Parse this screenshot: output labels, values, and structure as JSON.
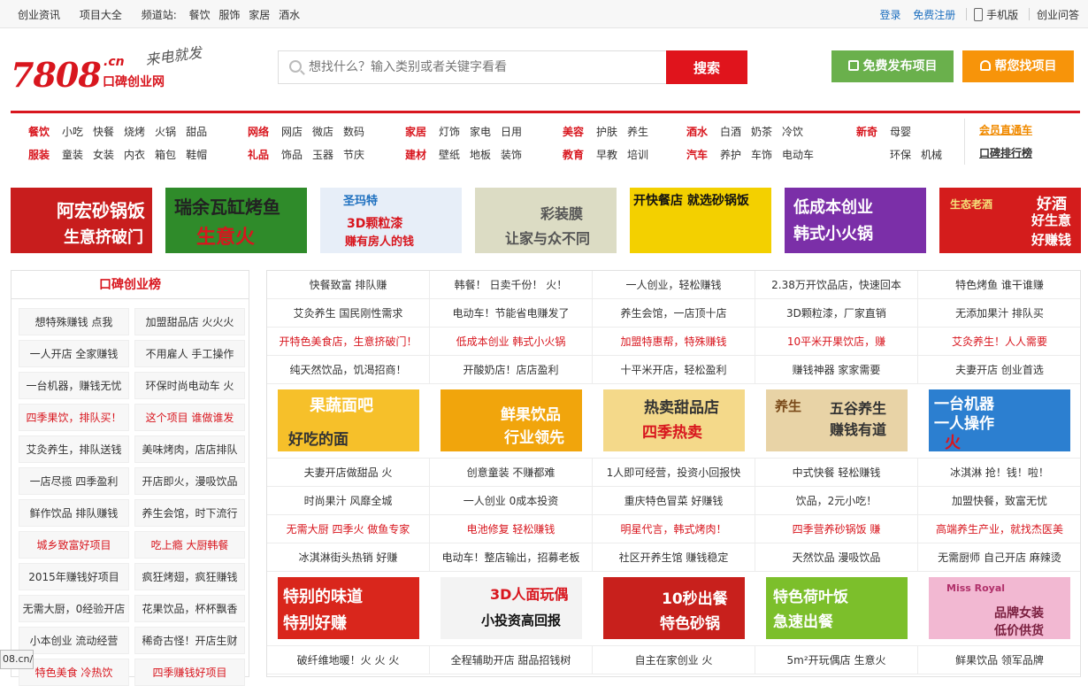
{
  "topbar": {
    "left": [
      "创业资讯",
      "项目大全"
    ],
    "channel_label": "频道站:",
    "channels": [
      "餐饮",
      "服饰",
      "家居",
      "酒水"
    ],
    "login": "登录",
    "register": "免费注册",
    "mobile": "手机版",
    "qa": "创业问答"
  },
  "header": {
    "logo_number": "7808",
    "logo_suffix": ".cn",
    "logo_name": "口碑创业网",
    "logo_slogan": "来电就发",
    "search_placeholder": "想找什么？输入类别或者关键字看看",
    "search_button": "搜索",
    "publish_button": "免费发布项目",
    "find_button": "帮您找项目"
  },
  "catnav": {
    "groups": [
      {
        "rows": [
          {
            "head": "餐饮",
            "items": [
              "小吃",
              "快餐",
              "烧烤",
              "火锅",
              "甜品"
            ]
          },
          {
            "head": "服装",
            "items": [
              "童装",
              "女装",
              "内衣",
              "箱包",
              "鞋帽"
            ]
          }
        ]
      },
      {
        "rows": [
          {
            "head": "网络",
            "items": [
              "网店",
              "微店",
              "数码"
            ]
          },
          {
            "head": "礼品",
            "items": [
              "饰品",
              "玉器",
              "节庆"
            ]
          }
        ]
      },
      {
        "rows": [
          {
            "head": "家居",
            "items": [
              "灯饰",
              "家电",
              "日用"
            ]
          },
          {
            "head": "建材",
            "items": [
              "壁纸",
              "地板",
              "装饰"
            ]
          }
        ]
      },
      {
        "rows": [
          {
            "head": "美容",
            "items": [
              "护肤",
              "养生"
            ]
          },
          {
            "head": "教育",
            "items": [
              "早教",
              "培训"
            ]
          }
        ]
      },
      {
        "rows": [
          {
            "head": "酒水",
            "items": [
              "白酒",
              "奶茶",
              "冷饮"
            ]
          },
          {
            "head": "汽车",
            "items": [
              "养护",
              "车饰",
              "电动车"
            ]
          }
        ]
      },
      {
        "rows": [
          {
            "head": "新奇",
            "items": [
              "母婴"
            ]
          },
          {
            "head": "",
            "items": [
              "环保",
              "机械"
            ]
          }
        ]
      }
    ],
    "member_link": "会员直通车",
    "rank_link": "口碑排行榜"
  },
  "banners": [
    {
      "name": "banner-ahong",
      "lines": [
        "阿宏砂锅饭",
        "生意挤破门"
      ],
      "bg": "#c81d1d"
    },
    {
      "name": "banner-ruiyu",
      "lines": [
        "瑞余瓦缸烤鱼",
        "生意火"
      ],
      "bg": "#2f8b2a"
    },
    {
      "name": "banner-shengma",
      "lines": [
        "圣玛特",
        "3D颗粒漆",
        "赚有房人的钱"
      ],
      "bg": "#e7eef8"
    },
    {
      "name": "banner-caizhuang",
      "lines": [
        "彩装膜",
        "让家与众不同"
      ],
      "bg": "#dcdcc4"
    },
    {
      "name": "banner-kuaican",
      "lines": [
        "开快餐店 就选砂锅饭"
      ],
      "bg": "#f3d000"
    },
    {
      "name": "banner-huoguo",
      "lines": [
        "低成本创业",
        "韩式小火锅"
      ],
      "bg": "#7b2fa8"
    },
    {
      "name": "banner-jiu",
      "lines": [
        "生态老酒",
        "好酒",
        "好生意",
        "好赚钱"
      ],
      "bg": "#d41c1c"
    }
  ],
  "leftpanel": {
    "title": "口碑创业榜",
    "items": [
      {
        "text": "想特殊赚钱 点我",
        "red": false
      },
      {
        "text": "加盟甜品店 火火火",
        "red": false
      },
      {
        "text": "一人开店 全家赚钱",
        "red": false
      },
      {
        "text": "不用雇人 手工操作",
        "red": false
      },
      {
        "text": "一台机器，赚钱无忧",
        "red": false
      },
      {
        "text": "环保时尚电动车 火",
        "red": false
      },
      {
        "text": "四季果饮，排队买！",
        "red": true
      },
      {
        "text": "这个项目 谁做谁发",
        "red": true
      },
      {
        "text": "艾灸养生，排队送钱",
        "red": false
      },
      {
        "text": "美味烤肉，店店排队",
        "red": false
      },
      {
        "text": "一店尽揽 四季盈利",
        "red": false
      },
      {
        "text": "开店即火，漫吸饮品",
        "red": false
      },
      {
        "text": "鲜作饮品 排队赚钱",
        "red": false
      },
      {
        "text": "养生会馆，时下流行",
        "red": false
      },
      {
        "text": "城乡致富好项目",
        "red": true
      },
      {
        "text": "吃上瘾 大厨韩餐",
        "red": true
      },
      {
        "text": "2015年赚钱好项目",
        "red": false
      },
      {
        "text": "疯狂烤翅，疯狂赚钱",
        "red": false
      },
      {
        "text": "无需大厨，0经验开店",
        "red": false
      },
      {
        "text": "花果饮品，杯杯飘香",
        "red": false
      },
      {
        "text": "小本创业 流动经营",
        "red": false
      },
      {
        "text": "稀奇古怪！开店生财",
        "red": false
      },
      {
        "text": "特色美食 冷热饮",
        "red": true
      },
      {
        "text": "四季赚钱好项目",
        "red": true
      }
    ]
  },
  "grid": {
    "rows1": [
      [
        {
          "t": "快餐致富 排队赚",
          "r": false
        },
        {
          "t": "韩餐！ 日卖千份！ 火！",
          "r": false
        },
        {
          "t": "一人创业，轻松赚钱",
          "r": false
        },
        {
          "t": "2.38万开饮品店，快速回本",
          "r": false
        },
        {
          "t": "特色烤鱼 谁干谁赚",
          "r": false
        }
      ],
      [
        {
          "t": "艾灸养生 国民刚性需求",
          "r": false
        },
        {
          "t": "电动车！节能省电赚发了",
          "r": false
        },
        {
          "t": "养生会馆，一店顶十店",
          "r": false
        },
        {
          "t": "3D颗粒漆，厂家直销",
          "r": false
        },
        {
          "t": "无添加果汁 排队买",
          "r": false
        }
      ],
      [
        {
          "t": "开特色美食店，生意挤破门！",
          "r": true
        },
        {
          "t": "低成本创业 韩式小火锅",
          "r": true
        },
        {
          "t": "加盟特惠帮，特殊赚钱",
          "r": true
        },
        {
          "t": "10平米开果饮店，赚",
          "r": true
        },
        {
          "t": "艾灸养生！人人需要",
          "r": true
        }
      ],
      [
        {
          "t": "纯天然饮品，饥渴招商！",
          "r": false
        },
        {
          "t": "开酸奶店！店店盈利",
          "r": false
        },
        {
          "t": "十平米开店，轻松盈利",
          "r": false
        },
        {
          "t": "赚钱神器 家家需要",
          "r": false
        },
        {
          "t": "夫妻开店 创业首选",
          "r": false
        }
      ]
    ],
    "ads1": [
      {
        "name": "ad-guoshu",
        "lines": [
          "果蔬面吧",
          "好吃的面"
        ],
        "bg": "#f6c02a"
      },
      {
        "name": "ad-xianguo",
        "lines": [
          "鲜果饮品",
          "行业领先"
        ],
        "bg": "#f1a50c"
      },
      {
        "name": "ad-tianpin",
        "lines": [
          "热卖甜品店",
          "四季热卖"
        ],
        "bg": "#f4d98a"
      },
      {
        "name": "ad-wugu",
        "lines": [
          "养生",
          "五谷养生",
          "赚钱有道"
        ],
        "bg": "#e8d3a6"
      },
      {
        "name": "ad-jiqi",
        "lines": [
          "一台机器",
          "一人操作",
          "火"
        ],
        "bg": "#2c7fd0"
      }
    ],
    "rows2": [
      [
        {
          "t": "夫妻开店做甜品 火",
          "r": false
        },
        {
          "t": "创意童装 不赚都难",
          "r": false
        },
        {
          "t": "1人即可经营，投资小回报快",
          "r": false
        },
        {
          "t": "中式快餐 轻松赚钱",
          "r": false
        },
        {
          "t": "冰淇淋 抢！钱！啦！",
          "r": false
        }
      ],
      [
        {
          "t": "时尚果汁 风靡全城",
          "r": false
        },
        {
          "t": "一人创业 0成本投资",
          "r": false
        },
        {
          "t": "重庆特色冒菜 好赚钱",
          "r": false
        },
        {
          "t": "饮品，2元小吃！",
          "r": false
        },
        {
          "t": "加盟快餐，致富无忧",
          "r": false
        }
      ],
      [
        {
          "t": "无需大厨 四季火 做鱼专家",
          "r": true
        },
        {
          "t": "电池修复 轻松赚钱",
          "r": true
        },
        {
          "t": "明星代言，韩式烤肉！",
          "r": true
        },
        {
          "t": "四季营养砂锅饭 赚",
          "r": true
        },
        {
          "t": "高端养生产业，就找杰医美",
          "r": true
        }
      ],
      [
        {
          "t": "冰淇淋街头热销 好赚",
          "r": false
        },
        {
          "t": "电动车！整店输出，招募老板",
          "r": false
        },
        {
          "t": "社区开养生馆 赚钱稳定",
          "r": false
        },
        {
          "t": "天然饮品 漫吸饮品",
          "r": false
        },
        {
          "t": "无需厨师 自己开店 麻辣烫",
          "r": false
        }
      ]
    ],
    "ads2": [
      {
        "name": "ad-weidao",
        "lines": [
          "特别的味道",
          "特别好赚"
        ],
        "bg": "#d9261c"
      },
      {
        "name": "ad-renou",
        "lines": [
          "3D人面玩偶",
          "小投资高回报"
        ],
        "bg": "#f3f3f3"
      },
      {
        "name": "ad-shaguo",
        "lines": [
          "10秒出餐",
          "特色砂锅"
        ],
        "bg": "#c8201c"
      },
      {
        "name": "ad-heye",
        "lines": [
          "特色荷叶饭",
          "急速出餐"
        ],
        "bg": "#7cbf2b"
      },
      {
        "name": "ad-nvzhuang",
        "lines": [
          "Miss Royal",
          "品牌女装",
          "低价供货"
        ],
        "bg": "#f2b8d2"
      }
    ],
    "rows3": [
      [
        {
          "t": "破纤维地暖！火 火 火",
          "r": false
        },
        {
          "t": "全程辅助开店 甜品招钱树",
          "r": false
        },
        {
          "t": "自主在家创业 火",
          "r": false
        },
        {
          "t": "5m²开玩偶店 生意火",
          "r": false
        },
        {
          "t": "鲜果饮品 领军品牌",
          "r": false
        }
      ]
    ]
  },
  "statusbar": "08.cn/"
}
